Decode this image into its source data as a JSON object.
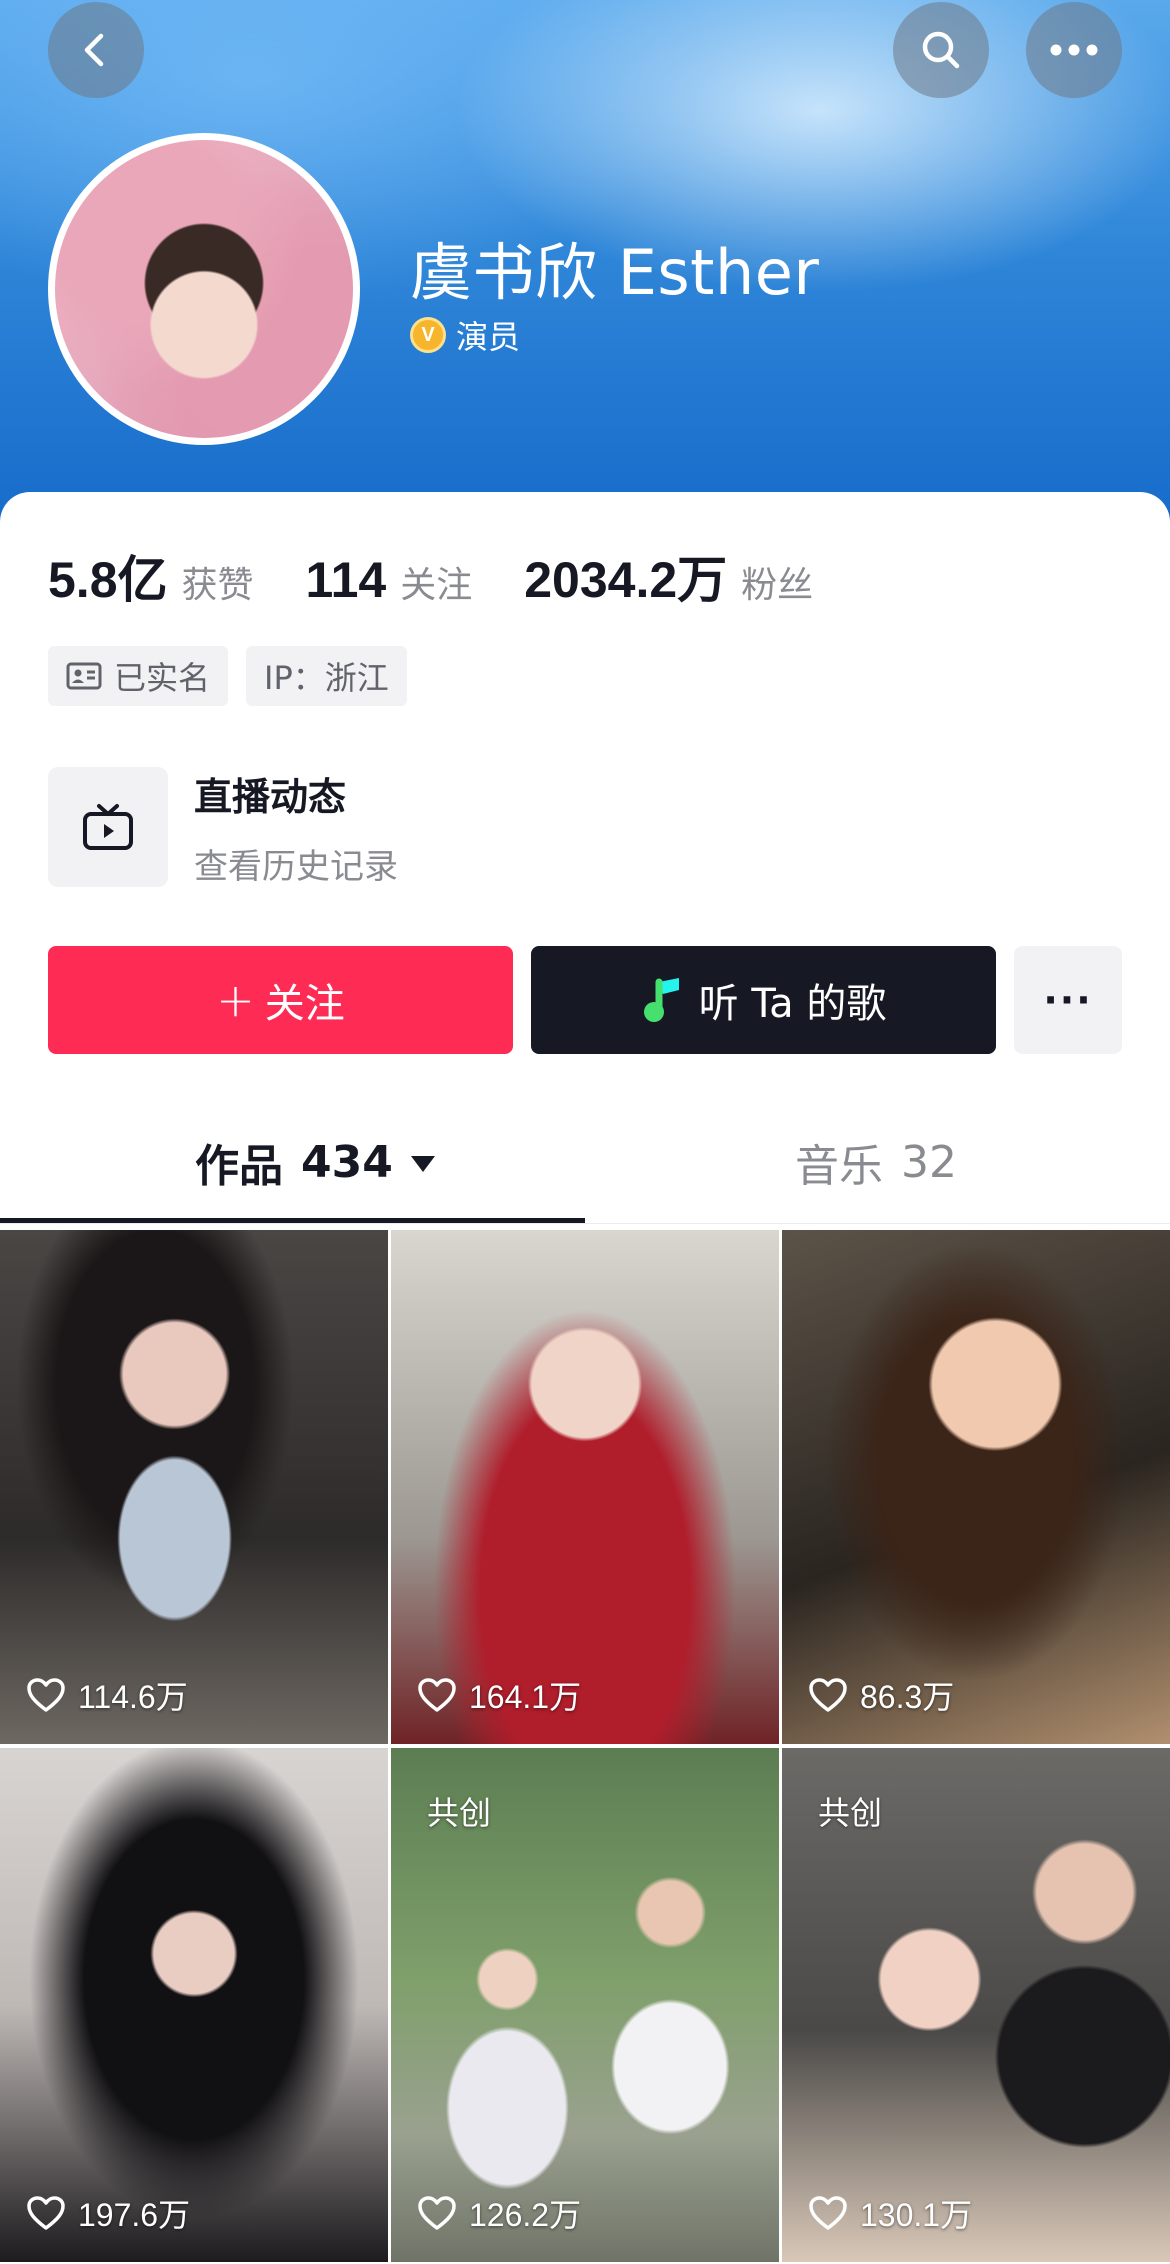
{
  "profile": {
    "name": "虞书欣 Esther",
    "verify_badge": "V",
    "verify_label": "演员"
  },
  "stats": [
    {
      "value": "5.8亿",
      "label": "获赞"
    },
    {
      "value": "114",
      "label": "关注"
    },
    {
      "value": "2034.2万",
      "label": "粉丝"
    }
  ],
  "tags": {
    "realname": "已实名",
    "ip": "IP：浙江"
  },
  "live": {
    "title": "直播动态",
    "subtitle": "查看历史记录"
  },
  "actions": {
    "follow_plus": "+",
    "follow_label": "关注",
    "music_label": "听 Ta 的歌",
    "more_label": "···"
  },
  "tabs": {
    "works_label": "作品",
    "works_count": "434",
    "music_label": "音乐",
    "music_count": "32"
  },
  "videos": [
    {
      "likes": "114.6万",
      "label": ""
    },
    {
      "likes": "164.1万",
      "label": ""
    },
    {
      "likes": "86.3万",
      "label": ""
    },
    {
      "likes": "197.6万",
      "label": ""
    },
    {
      "likes": "126.2万",
      "label": "共创"
    },
    {
      "likes": "130.1万",
      "label": "共创"
    }
  ],
  "colors": {
    "follow": "#fe2c55",
    "music_button": "#161823",
    "header": "#1468c9"
  },
  "icons": [
    "back-arrow-icon",
    "search-icon",
    "more-dots-icon",
    "verified-badge-icon",
    "id-card-icon",
    "live-tv-icon",
    "music-note-icon",
    "heart-icon",
    "dropdown-caret-icon"
  ]
}
